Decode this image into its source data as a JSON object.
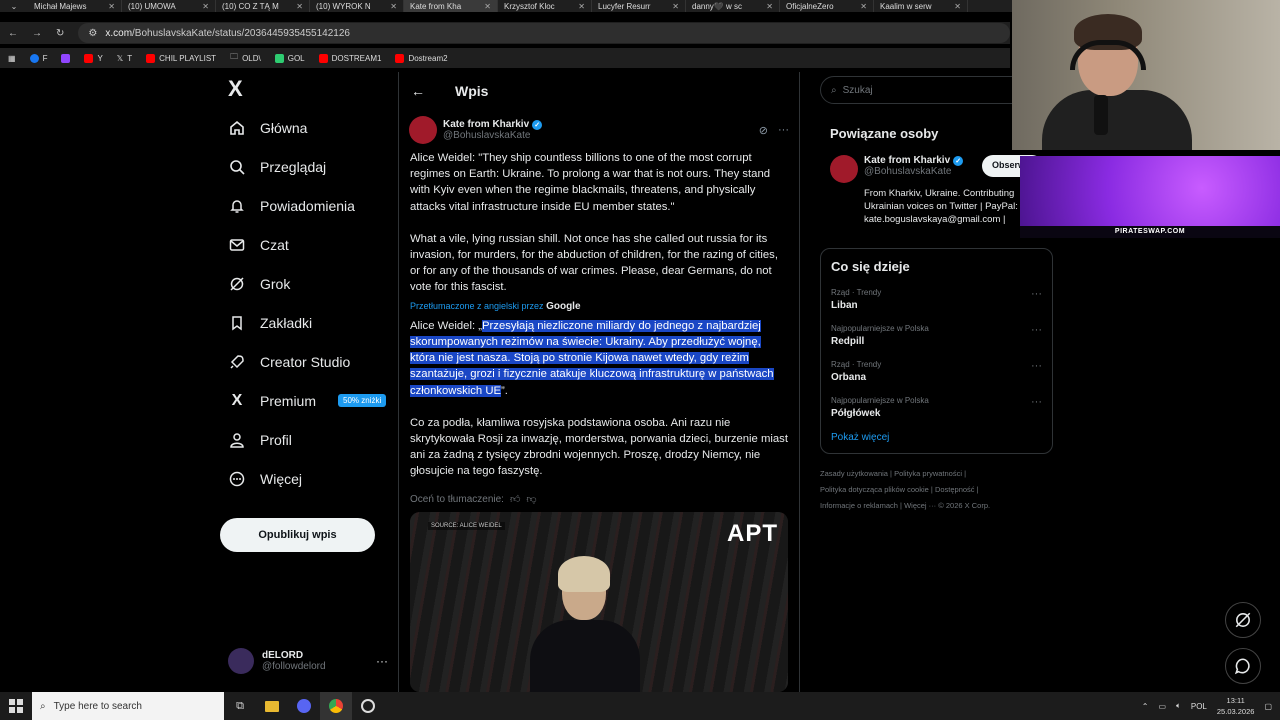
{
  "browser": {
    "tabs": [
      "Michał Majews",
      "(10) UMOWA",
      "(10) CO Z TĄ M",
      "(10) WYROK N",
      "Kate from Kha",
      "Krzysztof Kloc",
      "Lucyfer Resurr",
      "danny🖤 w sc",
      "OficjalneZero",
      "Kaalim w serw"
    ],
    "url_host": "x.com",
    "url_path": "/BohuslavskaKate/status/2036445935455142126",
    "bookmarks": [
      "F",
      "Y",
      "T",
      "CHIL PLAYLIST",
      "OLD\\",
      "GOL",
      "DOSTREAM1",
      "Dostream2"
    ]
  },
  "nav": {
    "logo": "X",
    "items": [
      "Główna",
      "Przeglądaj",
      "Powiadomienia",
      "Czat",
      "Grok",
      "Zakładki",
      "Creator Studio",
      "Premium",
      "Profil",
      "Więcej"
    ],
    "premium_badge": "50% zniżki",
    "publish": "Opublikuj wpis",
    "account_name": "dELORD",
    "account_handle": "@followdelord"
  },
  "post": {
    "header": "Wpis",
    "author_name": "Kate from Kharkiv",
    "author_handle": "@BohuslavskaKate",
    "original_p1": "Alice Weidel: \"They ship countless billions to one of the most corrupt regimes on Earth: Ukraine. To prolong a war that is not ours. They stand with Kyiv even when the regime blackmails, threatens, and physically attacks vital infrastructure inside EU member states.\"",
    "original_p2": "What a vile, lying russian shill. Not once has she called out russia for its invasion, for murders, for the abduction of children, for the razing of cities, or for any of the thousands of war crimes. Please, dear Germans, do not vote for this fascist.",
    "translated_by": "Przetłumaczone z angielski przez",
    "translated_by_brand": "Google",
    "translated_p1_prefix": "Alice Weidel: „",
    "translated_p1_selected": "Przesyłają niezliczone miliardy do jednego z najbardziej skorumpowanych reżimów na świecie: Ukrainy. Aby przedłużyć wojnę, która nie jest nasza. Stoją po stronie Kijowa nawet wtedy, gdy reżim szantażuje, grozi i fizycznie atakuje kluczową infrastrukturę w państwach członkowskich UE",
    "translated_p1_suffix": "”.",
    "translated_p2": "Co za podła, kłamliwa rosyjska podstawiona osoba. Ani razu nie skrytykowała Rosji za inwazję, morderstwa, porwania dzieci, burzenie miast ani za żadną z tysięcy zbrodni wojennych. Proszę, drodzy Niemcy, nie głosujcie na tego faszystę.",
    "rate_translation": "Oceń to tłumaczenie:",
    "media_tag": "SOURCE: ALICE WEIDEL",
    "media_logo": "APT"
  },
  "sidebar": {
    "search_placeholder": "Szukaj",
    "related_title": "Powiązane osoby",
    "related_name": "Kate from Kharkiv",
    "related_handle": "@BohuslavskaKate",
    "follow_label": "Obserwuj",
    "related_bio": "From Kharkiv, Ukraine. Contributing Ukrainian voices on Twitter | PayPal: kate.boguslavskaya@gmail.com |",
    "trends_title": "Co się dzieje",
    "trends": [
      {
        "meta": "Rząd · Trendy",
        "name": "Liban"
      },
      {
        "meta": "Najpopularniejsze w Polska",
        "name": "Redpill"
      },
      {
        "meta": "Rząd · Trendy",
        "name": "Orbana"
      },
      {
        "meta": "Najpopularniejsze w Polska",
        "name": "Półgłówek"
      }
    ],
    "show_more": "Pokaż więcej",
    "footer_links": [
      "Zasady użytkowania",
      "Polityka prywatności",
      "Polityka dotycząca plików cookie",
      "Dostępność",
      "Informacje o reklamach",
      "Więcej ···",
      "© 2026 X Corp."
    ]
  },
  "overlay": {
    "promo_text": "PIRATESWAP.COM"
  },
  "taskbar": {
    "search_placeholder": "Type here to search",
    "lang": "POL",
    "time": "13:11",
    "date": "25.03.2026"
  },
  "colors": {
    "accent": "#1d9bf0",
    "selection": "#1a47c5",
    "background": "#000000"
  }
}
